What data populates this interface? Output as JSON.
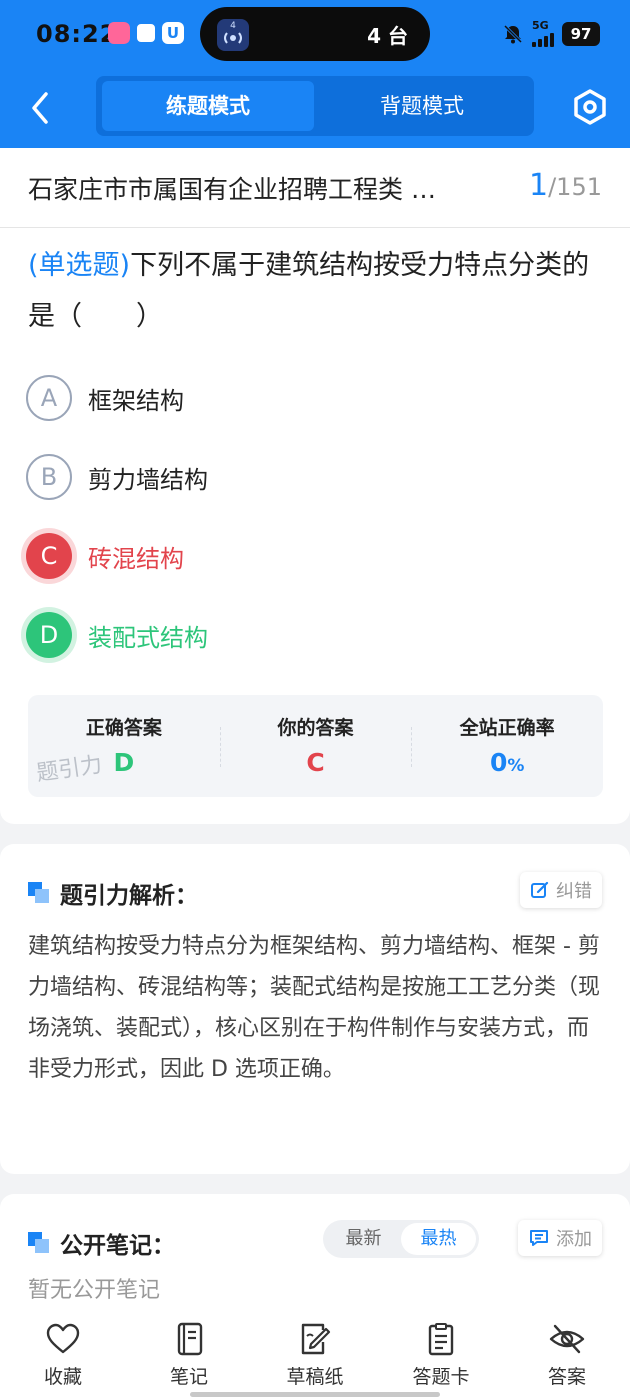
{
  "status_bar": {
    "time": "08:22",
    "island_text": "4 台",
    "island_icon_badge": "4",
    "network": "5G",
    "battery": "97"
  },
  "header": {
    "mode_practice": "练题模式",
    "mode_recite": "背题模式"
  },
  "title_bar": {
    "paper_title": "石家庄市市属国有企业招聘工程类 …",
    "current": "1",
    "total": "/151"
  },
  "question": {
    "type_label": "(单选题)",
    "stem": "下列不属于建筑结构按受力特点分类的是（　　）",
    "options": [
      {
        "letter": "A",
        "text": "框架结构",
        "state": "normal"
      },
      {
        "letter": "B",
        "text": "剪力墙结构",
        "state": "normal"
      },
      {
        "letter": "C",
        "text": "砖混结构",
        "state": "wrong"
      },
      {
        "letter": "D",
        "text": "装配式结构",
        "state": "correct"
      }
    ],
    "result": {
      "correct_label": "正确答案",
      "correct_value": "D",
      "your_label": "你的答案",
      "your_value": "C",
      "rate_label": "全站正确率",
      "rate_value": "0",
      "rate_unit": "%",
      "watermark": "题引力"
    }
  },
  "analysis": {
    "title": "题引力解析：",
    "report_label": "纠错",
    "text": "建筑结构按受力特点分为框架结构、剪力墙结构、框架 - 剪力墙结构、砖混结构等；装配式结构是按施工工艺分类（现场浇筑、装配式），核心区别在于构件制作与安装方式，而非受力形式，因此 D 选项正确。"
  },
  "notes": {
    "title": "公开笔记：",
    "sort_newest": "最新",
    "sort_hottest": "最热",
    "add_label": "添加",
    "empty_text": "暂无公开笔记"
  },
  "bottom_nav": [
    {
      "label": "收藏",
      "icon": "heart-icon"
    },
    {
      "label": "笔记",
      "icon": "notebook-icon"
    },
    {
      "label": "草稿纸",
      "icon": "draft-paper-icon"
    },
    {
      "label": "答题卡",
      "icon": "answer-sheet-icon"
    },
    {
      "label": "答案",
      "icon": "eye-hidden-icon"
    }
  ],
  "colors": {
    "brand": "#1a84f5",
    "correct": "#2dc57a",
    "wrong": "#e2444c"
  }
}
